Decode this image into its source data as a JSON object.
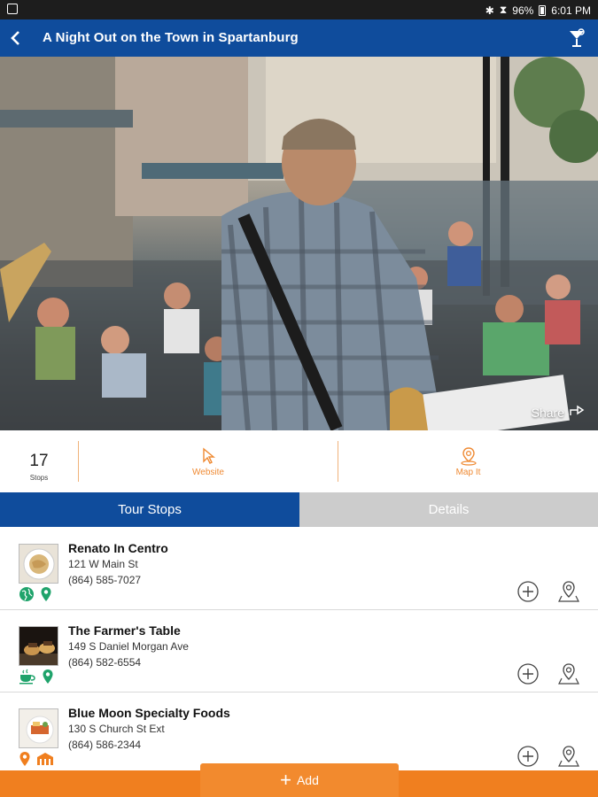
{
  "status_bar": {
    "battery": "96%",
    "time": "6:01 PM"
  },
  "app_bar": {
    "title": "A Night Out on the Town in Spartanburg"
  },
  "hero": {
    "share_label": "Share"
  },
  "stats": {
    "stops_count": "17",
    "stops_label": "Stops",
    "website_label": "Website",
    "map_label": "Map It"
  },
  "tabs": [
    {
      "label": "Tour Stops",
      "active": true
    },
    {
      "label": "Details",
      "active": false
    }
  ],
  "stops": [
    {
      "name": "Renato In Centro",
      "address": "121 W Main St",
      "phone": "(864) 585-7027",
      "tags": [
        "globe-icon",
        "map-pin-icon"
      ]
    },
    {
      "name": "The Farmer's Table",
      "address": "149 S Daniel Morgan Ave",
      "phone": "(864) 582-6554",
      "tags": [
        "teacup-icon",
        "map-pin-icon"
      ]
    },
    {
      "name": "Blue Moon Specialty Foods",
      "address": "130 S Church St Ext",
      "phone": "(864) 586-2344",
      "tags": [
        "map-pin-icon",
        "barn-icon"
      ]
    }
  ],
  "footer": {
    "add_label": "Add"
  },
  "colors": {
    "brand_blue": "#0f4c9c",
    "accent_orange": "#f07f1f",
    "tag_green": "#1fa36b"
  }
}
